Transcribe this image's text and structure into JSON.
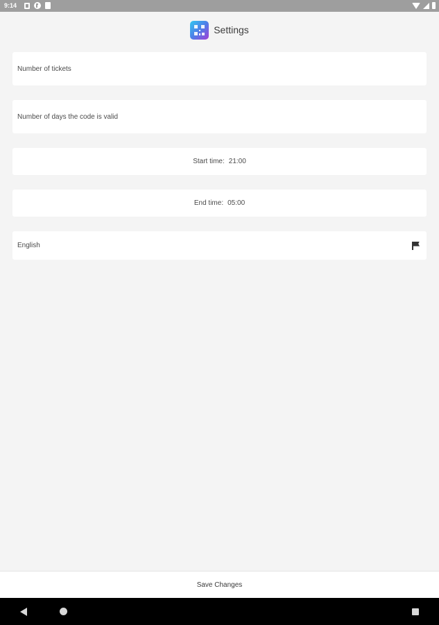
{
  "status_bar": {
    "time": "9:14",
    "left_icons": [
      "notification-square-icon",
      "cast-circle-icon",
      "clipboard-icon"
    ],
    "right_icons": [
      "wifi-icon",
      "signal-icon",
      "battery-icon"
    ]
  },
  "header": {
    "title": "Settings",
    "logo_icon": "qr-code-logo-icon"
  },
  "fields": {
    "tickets_label": "Number of tickets",
    "days_label": "Number of days the code is valid"
  },
  "times": {
    "start_label": "Start time:",
    "start_value": "21:00",
    "end_label": "End time:",
    "end_value": "05:00"
  },
  "language": {
    "selected": "English",
    "icon": "flag-icon"
  },
  "save": {
    "label": "Save Changes"
  },
  "nav": {
    "icons": [
      "back-icon",
      "home-icon",
      "recents-icon"
    ]
  },
  "colors": {
    "background": "#f4f4f4",
    "card": "#ffffff",
    "status_bar": "#9e9e9e",
    "nav_bar": "#000000",
    "logo_gradient": [
      "#33c8f0",
      "#4e7fe8",
      "#a23fd6"
    ]
  }
}
